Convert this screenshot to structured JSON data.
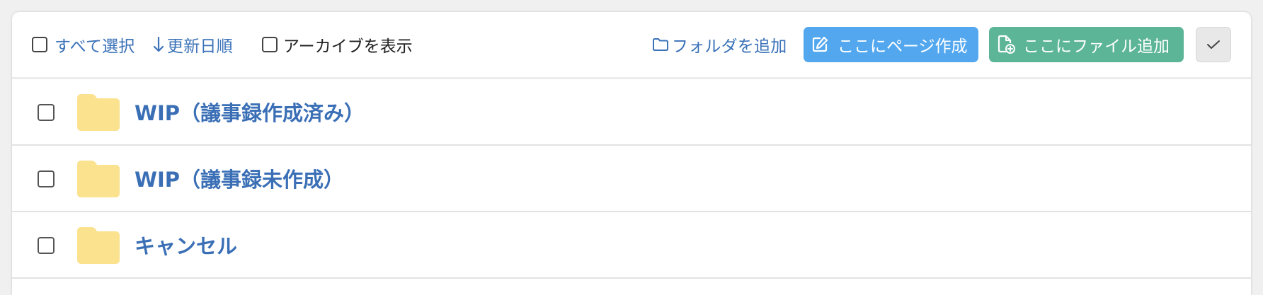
{
  "toolbar": {
    "select_all_label": "すべて選択",
    "sort_label": "更新日順",
    "archive_label": "アーカイブを表示",
    "add_folder_label": "フォルダを追加",
    "create_page_label": "ここにページ作成",
    "add_file_label": "ここにファイル追加"
  },
  "items": [
    {
      "name": "WIP（議事録作成済み）"
    },
    {
      "name": "WIP（議事録未作成）"
    },
    {
      "name": "キャンセル"
    }
  ],
  "colors": {
    "link": "#3b72b8",
    "primary_button": "#52a7ee",
    "success_button": "#5cb597",
    "folder": "#fbe28f"
  }
}
